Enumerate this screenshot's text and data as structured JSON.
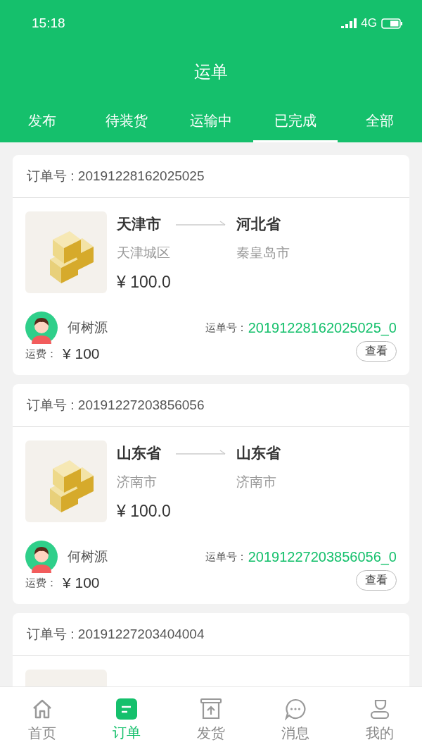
{
  "status_bar": {
    "time": "15:18",
    "network": "4G"
  },
  "header": {
    "title": "运单"
  },
  "tabs": [
    {
      "label": "发布",
      "selected": false
    },
    {
      "label": "待装货",
      "selected": false
    },
    {
      "label": "运输中",
      "selected": false
    },
    {
      "label": "已完成",
      "selected": true
    },
    {
      "label": "全部",
      "selected": false
    }
  ],
  "orders": [
    {
      "order_no": "订单号 : 20191228162025025",
      "from": {
        "city": "天津市",
        "district": "天津城区"
      },
      "to": {
        "city": "河北省",
        "district": "秦皇岛市"
      },
      "price": "¥ 100.0",
      "driver": "何树源",
      "waybill_label": "运单号 :",
      "waybill_no": "20191228162025025_0",
      "fee_label": "运费：",
      "fee": "¥ 100",
      "button": "查看"
    },
    {
      "order_no": "订单号 : 20191227203856056",
      "from": {
        "city": "山东省",
        "district": "济南市"
      },
      "to": {
        "city": "山东省",
        "district": "济南市"
      },
      "price": "¥ 100.0",
      "driver": "何树源",
      "waybill_label": "运单号 :",
      "waybill_no": "20191227203856056_0",
      "fee_label": "运费：",
      "fee": "¥ 100",
      "button": "查看"
    },
    {
      "order_no": "订单号 : 20191227203404004"
    }
  ],
  "bottom_nav": [
    {
      "label": "首页",
      "kind": "home",
      "selected": false
    },
    {
      "label": "订单",
      "kind": "orders",
      "selected": true
    },
    {
      "label": "发货",
      "kind": "ship",
      "selected": false
    },
    {
      "label": "消息",
      "kind": "message",
      "selected": false
    },
    {
      "label": "我的",
      "kind": "profile",
      "selected": false
    }
  ]
}
